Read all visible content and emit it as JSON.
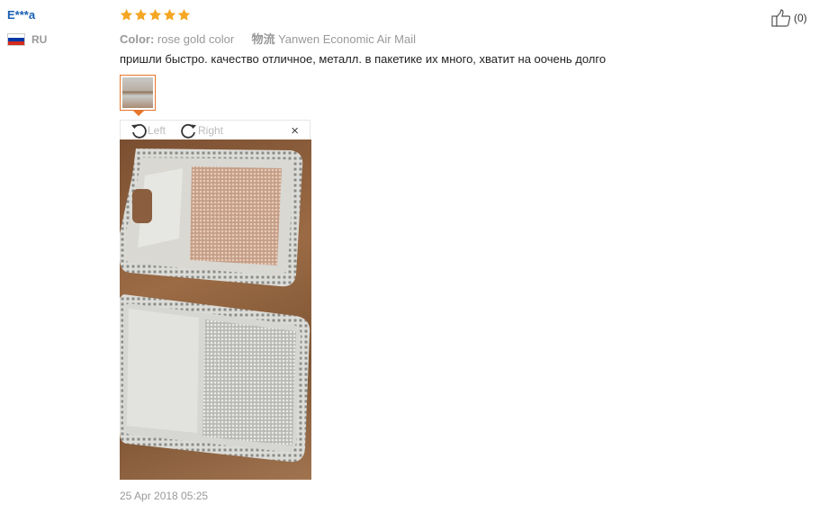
{
  "reviewer": {
    "name": "E***a",
    "country_code": "RU"
  },
  "colors": {
    "star": "#f5a623",
    "accent": "#e8762b",
    "username": "#1a5fb4"
  },
  "rating": {
    "stars": 5,
    "max": 5
  },
  "meta": {
    "color_label": "Color:",
    "color_value": "rose gold color",
    "logistics_label": "物流",
    "logistics_value": "Yanwen Economic Air Mail"
  },
  "review_text": "пришли быстро. качество отличное, металл. в пакетике их много, хватит на оочень долго",
  "viewer": {
    "rotate_left_label": "Left",
    "rotate_right_label": "Right",
    "close_label": "×"
  },
  "date": "25 Apr 2018 05:25",
  "helpful": {
    "count_text": "(0)",
    "icon": "thumbs-up-icon"
  }
}
